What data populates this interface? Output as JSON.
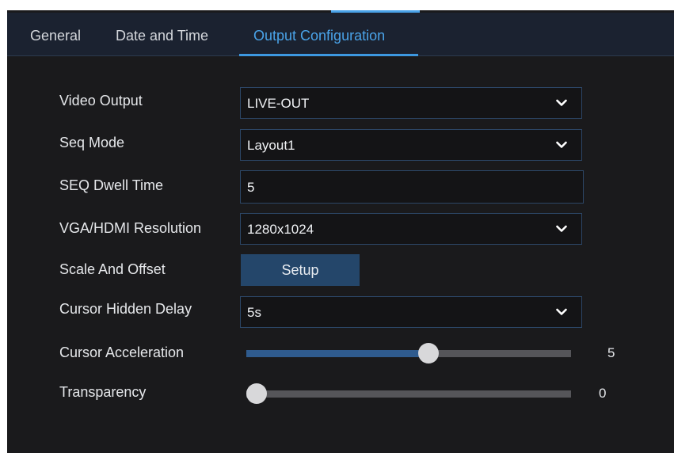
{
  "tabs": {
    "general": "General",
    "date_time": "Date and Time",
    "output_config": "Output Configuration"
  },
  "fields": {
    "video_output": {
      "label": "Video Output",
      "value": "LIVE-OUT"
    },
    "seq_mode": {
      "label": "Seq Mode",
      "value": "Layout1"
    },
    "seq_dwell_time": {
      "label": "SEQ Dwell Time",
      "value": "5"
    },
    "resolution": {
      "label": "VGA/HDMI Resolution",
      "value": "1280x1024"
    },
    "scale_offset": {
      "label": "Scale And Offset",
      "button": "Setup"
    },
    "cursor_hidden_delay": {
      "label": "Cursor Hidden Delay",
      "value": "5s"
    },
    "cursor_acceleration": {
      "label": "Cursor Acceleration",
      "value": "5",
      "fraction": 0.56
    },
    "transparency": {
      "label": "Transparency",
      "value": "0",
      "fraction": 0.0
    }
  },
  "colors": {
    "accent": "#4aa3e8",
    "background": "#1a1a1c",
    "tabbar": "#1b2230",
    "button": "#24466a",
    "slider_fill": "#2f5b8e"
  },
  "icons": {
    "dropdown": "chevron-down-icon"
  }
}
